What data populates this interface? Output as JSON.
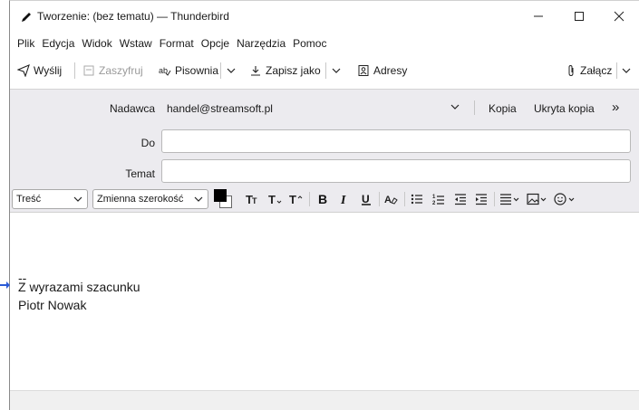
{
  "window": {
    "title": "Tworzenie: (bez tematu) — Thunderbird",
    "controls": {
      "minimize": "—",
      "maximize": "☐",
      "close": "✕"
    }
  },
  "menubar": {
    "items": [
      "Plik",
      "Edycja",
      "Widok",
      "Wstaw",
      "Format",
      "Opcje",
      "Narzędzia",
      "Pomoc"
    ]
  },
  "toolbar": {
    "send_label": "Wyślij",
    "encrypt_label": "Zaszyfruj",
    "spelling_label": "Pisownia",
    "save_label": "Zapisz jako",
    "addresses_label": "Adresy",
    "attach_label": "Załącz"
  },
  "headers": {
    "from_label": "Nadawca",
    "from_value": "handel@streamsoft.pl",
    "cc_label": "Kopia",
    "bcc_label": "Ukryta kopia",
    "more_label": "»",
    "to_label": "Do",
    "to_value": "",
    "subject_label": "Temat",
    "subject_value": ""
  },
  "format_bar": {
    "paragraph_style": "Treść",
    "font_family": "Zmienna szerokość",
    "text_color": "#000000",
    "bg_color": "#ffffff"
  },
  "body": {
    "signature_separator": "--",
    "signature_line1": "Z wyrazami szacunku",
    "signature_line2": "Piotr Nowak"
  }
}
